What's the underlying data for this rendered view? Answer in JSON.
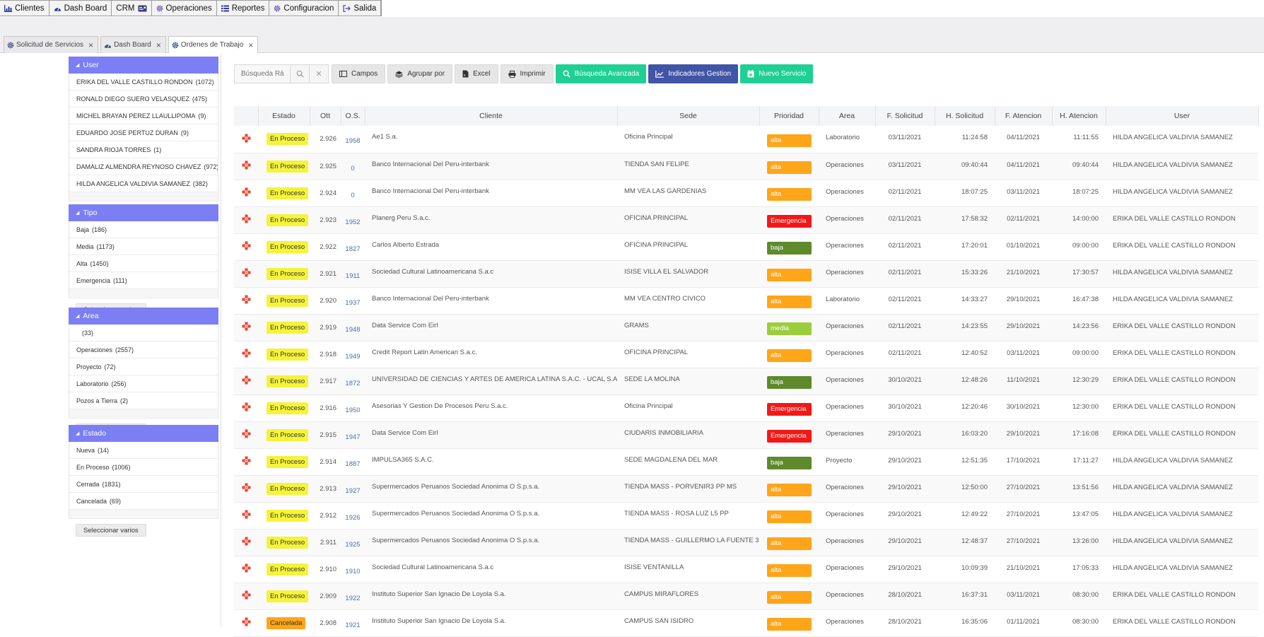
{
  "menu": [
    {
      "label": "Clientes",
      "icon": "bar-chart-icon"
    },
    {
      "label": "Dash Board",
      "icon": "dashboard-gauge-icon"
    },
    {
      "label": "CRM",
      "icon": "id-card-icon"
    },
    {
      "label": "Operaciones",
      "icon": "gear-icon"
    },
    {
      "label": "Reportes",
      "icon": "list-icon"
    },
    {
      "label": "Configuracion",
      "icon": "gear-icon"
    },
    {
      "label": "Salida",
      "icon": "sign-out-icon"
    }
  ],
  "tabs": [
    {
      "label": "Solicitud de Servicios",
      "icon": "gear-icon",
      "active": false
    },
    {
      "label": "Dash Board",
      "icon": "dashboard-gauge-icon",
      "active": false
    },
    {
      "label": "Ordenes de Trabajo",
      "icon": "gear-icon",
      "active": true
    }
  ],
  "tab_close": "×",
  "filters": [
    {
      "title": "User",
      "items": [
        {
          "label": "ERIKA DEL VALLE CASTILLO RONDON",
          "count": "(1072)"
        },
        {
          "label": "RONALD DIEGO SUERO VELASQUEZ",
          "count": "(475)"
        },
        {
          "label": "MICHEL BRAYAN PEREZ LLAULLIPOMA",
          "count": "(9)"
        },
        {
          "label": "EDUARDO JOSE PERTUZ DURAN",
          "count": "(9)"
        },
        {
          "label": "SANDRA RIOJA TORRES",
          "count": "(1)"
        },
        {
          "label": "DAMALIZ ALMENDRA REYNOSO CHAVEZ",
          "count": "(972)"
        },
        {
          "label": "HILDA ANGELICA VALDIVIA SAMANEZ",
          "count": "(382)"
        }
      ],
      "button": "Seleccionar varios"
    },
    {
      "title": "Tipo",
      "items": [
        {
          "label": "Baja",
          "count": "(186)"
        },
        {
          "label": "Media",
          "count": "(1173)"
        },
        {
          "label": "Alta",
          "count": "(1450)"
        },
        {
          "label": "Emergencia",
          "count": "(111)"
        }
      ],
      "button": "Seleccionar varios"
    },
    {
      "title": "Area",
      "items": [
        {
          "label": "",
          "count": "(33)"
        },
        {
          "label": "Operaciones",
          "count": "(2557)"
        },
        {
          "label": "Proyecto",
          "count": "(72)"
        },
        {
          "label": "Laboratorio",
          "count": "(256)"
        },
        {
          "label": "Pozos a Tierra",
          "count": "(2)"
        }
      ],
      "button": "Seleccionar varios"
    },
    {
      "title": "Estado",
      "items": [
        {
          "label": "Nueva",
          "count": "(14)"
        },
        {
          "label": "En Proceso",
          "count": "(1006)"
        },
        {
          "label": "Cerrada",
          "count": "(1831)"
        },
        {
          "label": "Cancelada",
          "count": "(69)"
        }
      ],
      "button": "Seleccionar varios"
    }
  ],
  "toolbar": {
    "search_placeholder": "Búsqueda Rá",
    "campos": "Campos",
    "agrupar": "Agrupar por",
    "excel": "Excel",
    "imprimir": "Imprimir",
    "busqueda_avanzada": "Búsqueda Avanzada",
    "indicadores": "Indicadores Gestion",
    "nuevo": "Nuevo Servicio"
  },
  "colors": {
    "filter_header": "#7b7ff3",
    "en_proceso": "#f5f33a",
    "cancelada": "#ffa519",
    "alta": "#ffa519",
    "baja": "#5e8a2c",
    "media": "#9ccd3c",
    "emergencia": "#f21818",
    "cross": "#e8452f",
    "green_button": "#1fcf94",
    "navy_button": "#4154a6"
  },
  "table": {
    "columns": [
      "",
      "Estado",
      "Ott",
      "O.S.",
      "Cliente",
      "Sede",
      "Prioridad",
      "Area",
      "F. Solicitud",
      "H. Solicitud",
      "F. Atencion",
      "H. Atencion",
      "User"
    ],
    "rows": [
      {
        "estado": "En Proceso",
        "ott": "2.926",
        "os": "1958",
        "cliente": "Ae1 S.a.",
        "sede": "Oficina Principal",
        "prioridad": "alta",
        "area": "Laboratorio",
        "fsol": "03/11/2021",
        "hsol": "11:24:58",
        "fate": "04/11/2021",
        "hate": "11:11:55",
        "user": "HILDA ANGELICA VALDIVIA SAMANEZ"
      },
      {
        "estado": "En Proceso",
        "ott": "2.925",
        "os": "0",
        "cliente": "Banco Internacional Del Peru-interbank",
        "sede": "TIENDA SAN FELIPE",
        "prioridad": "alta",
        "area": "Operaciones",
        "fsol": "03/11/2021",
        "hsol": "09:40:44",
        "fate": "04/11/2021",
        "hate": "09:40:44",
        "user": "HILDA ANGELICA VALDIVIA SAMANEZ"
      },
      {
        "estado": "En Proceso",
        "ott": "2.924",
        "os": "0",
        "cliente": "Banco Internacional Del Peru-interbank",
        "sede": "MM VEA LAS GARDENIAS",
        "prioridad": "alta",
        "area": "Operaciones",
        "fsol": "02/11/2021",
        "hsol": "18:07:25",
        "fate": "03/11/2021",
        "hate": "18:07:25",
        "user": "HILDA ANGELICA VALDIVIA SAMANEZ"
      },
      {
        "estado": "En Proceso",
        "ott": "2.923",
        "os": "1952",
        "cliente": "Planerg Peru S.a.c.",
        "sede": "OFICINA PRINCIPAL",
        "prioridad": "Emergencia",
        "area": "Operaciones",
        "fsol": "02/11/2021",
        "hsol": "17:58:32",
        "fate": "02/11/2021",
        "hate": "14:00:00",
        "user": "ERIKA DEL VALLE CASTILLO RONDON"
      },
      {
        "estado": "En Proceso",
        "ott": "2.922",
        "os": "1827",
        "cliente": "Carlos Alberto Estrada",
        "sede": "OFICINA PRINCIPAL",
        "prioridad": "baja",
        "area": "Operaciones",
        "fsol": "02/11/2021",
        "hsol": "17:20:01",
        "fate": "01/10/2021",
        "hate": "09:00:00",
        "user": "ERIKA DEL VALLE CASTILLO RONDON"
      },
      {
        "estado": "En Proceso",
        "ott": "2.921",
        "os": "1911",
        "cliente": "Sociedad Cultural Latinoamericana S.a.c",
        "sede": "ISISE VILLA EL SALVADOR",
        "prioridad": "alta",
        "area": "Operaciones",
        "fsol": "02/11/2021",
        "hsol": "15:33:26",
        "fate": "21/10/2021",
        "hate": "17:30:57",
        "user": "HILDA ANGELICA VALDIVIA SAMANEZ"
      },
      {
        "estado": "En Proceso",
        "ott": "2.920",
        "os": "1937",
        "cliente": "Banco Internacional Del Peru-interbank",
        "sede": "MM VEA CENTRO CIVICO",
        "prioridad": "alta",
        "area": "Laboratorio",
        "fsol": "02/11/2021",
        "hsol": "14:33:27",
        "fate": "29/10/2021",
        "hate": "16:47:38",
        "user": "HILDA ANGELICA VALDIVIA SAMANEZ"
      },
      {
        "estado": "En Proceso",
        "ott": "2.919",
        "os": "1948",
        "cliente": "Data Service Com Eirl",
        "sede": "GRAMS",
        "prioridad": "media",
        "area": "Operaciones",
        "fsol": "02/11/2021",
        "hsol": "14:23:55",
        "fate": "29/10/2021",
        "hate": "14:23:56",
        "user": "ERIKA DEL VALLE CASTILLO RONDON"
      },
      {
        "estado": "En Proceso",
        "ott": "2.918",
        "os": "1949",
        "cliente": "Credit Report Latin American S.a.c.",
        "sede": "OFICINA PRINCIPAL",
        "prioridad": "alta",
        "area": "Operaciones",
        "fsol": "02/11/2021",
        "hsol": "12:40:52",
        "fate": "03/11/2021",
        "hate": "09:00:00",
        "user": "ERIKA DEL VALLE CASTILLO RONDON"
      },
      {
        "estado": "En Proceso",
        "ott": "2.917",
        "os": "1872",
        "cliente": "UNIVERSIDAD DE CIENCIAS Y ARTES DE AMERICA LATINA S.A.C. - UCAL S.A.C.",
        "sede": "SEDE LA MOLINA",
        "prioridad": "baja",
        "area": "Operaciones",
        "fsol": "30/10/2021",
        "hsol": "12:48:26",
        "fate": "11/10/2021",
        "hate": "12:30:29",
        "user": "ERIKA DEL VALLE CASTILLO RONDON"
      },
      {
        "estado": "En Proceso",
        "ott": "2.916",
        "os": "1950",
        "cliente": "Asesorias Y Gestion De Procesos Peru S.a.c.",
        "sede": "Oficina Principal",
        "prioridad": "Emergencia",
        "area": "Operaciones",
        "fsol": "30/10/2021",
        "hsol": "12:20:46",
        "fate": "30/10/2021",
        "hate": "12:30:00",
        "user": "ERIKA DEL VALLE CASTILLO RONDON"
      },
      {
        "estado": "En Proceso",
        "ott": "2.915",
        "os": "1947",
        "cliente": "Data Service Com Eirl",
        "sede": "CIUDARIS INMOBILIARIA",
        "prioridad": "Emergencia",
        "area": "Operaciones",
        "fsol": "29/10/2021",
        "hsol": "16:03:20",
        "fate": "29/10/2021",
        "hate": "17:16:08",
        "user": "ERIKA DEL VALLE CASTILLO RONDON"
      },
      {
        "estado": "En Proceso",
        "ott": "2.914",
        "os": "1887",
        "cliente": "IMPULSA365 S.A.C.",
        "sede": "SEDE MAGDALENA DEL MAR",
        "prioridad": "baja",
        "area": "Proyecto",
        "fsol": "29/10/2021",
        "hsol": "12:51:35",
        "fate": "17/10/2021",
        "hate": "17:11:27",
        "user": "HILDA ANGELICA VALDIVIA SAMANEZ"
      },
      {
        "estado": "En Proceso",
        "ott": "2.913",
        "os": "1927",
        "cliente": "Supermercados Peruanos Sociedad Anonima O S.p.s.a.",
        "sede": "TIENDA MASS - PORVENIR3 PP MS",
        "prioridad": "alta",
        "area": "Operaciones",
        "fsol": "29/10/2021",
        "hsol": "12:50:00",
        "fate": "27/10/2021",
        "hate": "13:51:56",
        "user": "HILDA ANGELICA VALDIVIA SAMANEZ"
      },
      {
        "estado": "En Proceso",
        "ott": "2.912",
        "os": "1926",
        "cliente": "Supermercados Peruanos Sociedad Anonima O S.p.s.a.",
        "sede": "TIENDA MASS - ROSA LUZ L5 PP",
        "prioridad": "alta",
        "area": "Operaciones",
        "fsol": "29/10/2021",
        "hsol": "12:49:22",
        "fate": "27/10/2021",
        "hate": "13:47:05",
        "user": "HILDA ANGELICA VALDIVIA SAMANEZ"
      },
      {
        "estado": "En Proceso",
        "ott": "2.911",
        "os": "1925",
        "cliente": "Supermercados Peruanos Sociedad Anonima O S.p.s.a.",
        "sede": "TIENDA MASS - GUILLERMO LA FUENTE 3",
        "prioridad": "alta",
        "area": "Operaciones",
        "fsol": "29/10/2021",
        "hsol": "12:48:37",
        "fate": "27/10/2021",
        "hate": "13:26:00",
        "user": "HILDA ANGELICA VALDIVIA SAMANEZ"
      },
      {
        "estado": "En Proceso",
        "ott": "2.910",
        "os": "1910",
        "cliente": "Sociedad Cultural Latinoamericana S.a.c",
        "sede": "ISISE VENTANILLA",
        "prioridad": "alta",
        "area": "Operaciones",
        "fsol": "29/10/2021",
        "hsol": "10:09:39",
        "fate": "21/10/2021",
        "hate": "17:05:33",
        "user": "HILDA ANGELICA VALDIVIA SAMANEZ"
      },
      {
        "estado": "En Proceso",
        "ott": "2.909",
        "os": "1922",
        "cliente": "Instituto Superior San Ignacio De Loyola S.a.",
        "sede": "CAMPUS MIRAFLORES",
        "prioridad": "alta",
        "area": "Operaciones",
        "fsol": "28/10/2021",
        "hsol": "16:37:31",
        "fate": "03/11/2021",
        "hate": "08:30:00",
        "user": "ERIKA DEL VALLE CASTILLO RONDON"
      },
      {
        "estado": "Cancelada",
        "ott": "2.908",
        "os": "1921",
        "cliente": "Instituto Superior San Ignacio De Loyola S.a.",
        "sede": "CAMPUS SAN ISIDRO",
        "prioridad": "alta",
        "area": "Operaciones",
        "fsol": "28/10/2021",
        "hsol": "16:35:06",
        "fate": "01/11/2021",
        "hate": "08:30:00",
        "user": "ERIKA DEL VALLE CASTILLO RONDON"
      }
    ]
  }
}
